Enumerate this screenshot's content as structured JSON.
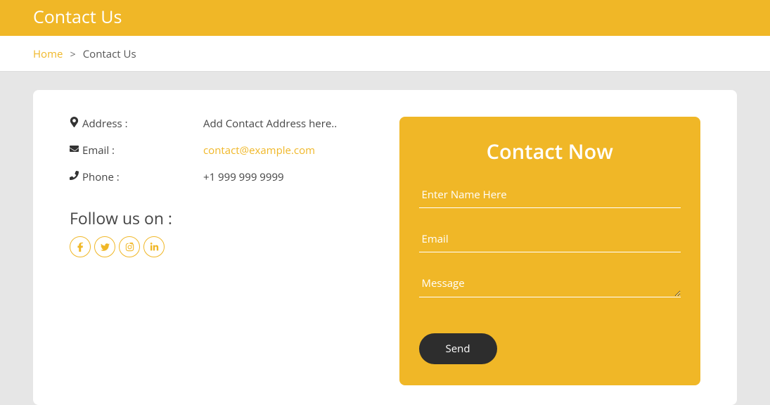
{
  "header": {
    "title": "Contact Us"
  },
  "breadcrumb": {
    "home": "Home",
    "sep": ">",
    "current": "Contact Us"
  },
  "info": {
    "address_label": "Address :",
    "address_value": "Add Contact Address here..",
    "email_label": "Email :",
    "email_value": "contact@example.com",
    "phone_label": "Phone :",
    "phone_value": "+1 999 999 9999"
  },
  "follow": {
    "heading": "Follow us on :"
  },
  "form": {
    "title": "Contact Now",
    "name_placeholder": "Enter Name Here",
    "email_placeholder": "Email",
    "message_placeholder": "Message",
    "send_label": "Send"
  }
}
